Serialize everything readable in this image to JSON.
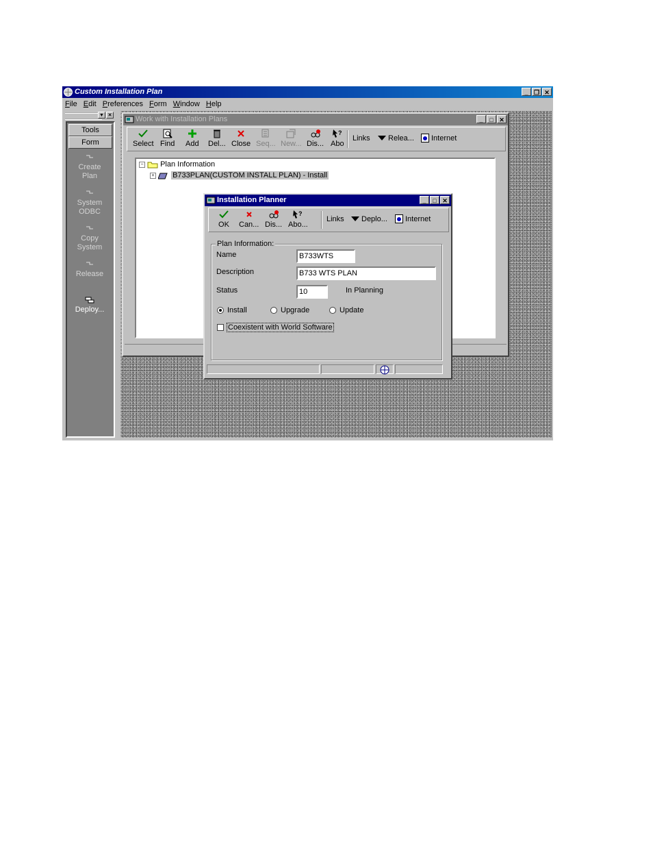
{
  "app": {
    "title": "Custom Installation Plan",
    "menu": [
      "File",
      "Edit",
      "Preferences",
      "Form",
      "Window",
      "Help"
    ]
  },
  "sidebar": {
    "tabs": [
      "Tools",
      "Form"
    ],
    "items": [
      {
        "label_1": "Create",
        "label_2": "Plan"
      },
      {
        "label_1": "System",
        "label_2": "ODBC"
      },
      {
        "label_1": "Copy",
        "label_2": "System"
      },
      {
        "label_1": "Release",
        "label_2": ""
      },
      {
        "label_1": "Deploy...",
        "label_2": ""
      }
    ]
  },
  "work_window": {
    "title": "Work with Installation Plans",
    "toolbar": {
      "buttons": [
        "Select",
        "Find",
        "Add",
        "Del...",
        "Close",
        "Seq...",
        "New...",
        "Dis...",
        "Abo"
      ],
      "links": "Links",
      "release": "Relea...",
      "internet": "Internet"
    },
    "tree": {
      "root": "Plan Information",
      "child": "B733PLAN(CUSTOM INSTALL PLAN) - Install"
    }
  },
  "planner": {
    "title": "Installation Planner",
    "toolbar": {
      "buttons": [
        "OK",
        "Can...",
        "Dis...",
        "Abo..."
      ],
      "links": "Links",
      "deploy": "Deplo...",
      "internet": "Internet"
    },
    "group_title": "Plan Information:",
    "name_label": "Name",
    "name_value": "B733WTS",
    "description_label": "Description",
    "description_value": "B733 WTS PLAN",
    "status_label": "Status",
    "status_value": "10",
    "status_text": "In Planning",
    "radio_install": "Install",
    "radio_upgrade": "Upgrade",
    "radio_update": "Update",
    "selected_radio": "Install",
    "coexistent_label": "Coexistent with World Software",
    "coexistent_checked": false
  },
  "colors": {
    "active_title": "#000080",
    "inactive_title": "#808080",
    "face": "#c0c0c0"
  }
}
